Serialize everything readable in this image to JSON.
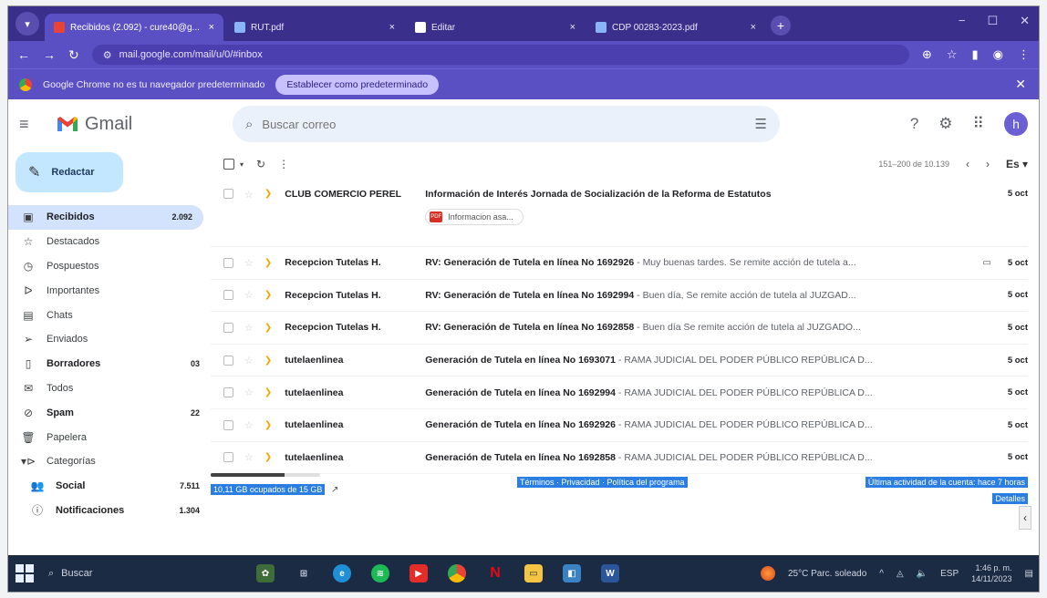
{
  "browser": {
    "tabs": [
      {
        "title": "Recibidos (2.092) - cure40@g...",
        "favicon_color": "#ea4335",
        "active": true
      },
      {
        "title": "RUT.pdf",
        "favicon_color": "#8ab4f8",
        "active": false
      },
      {
        "title": "Editar",
        "favicon_color": "#ffffff",
        "active": false
      },
      {
        "title": "CDP 00283-2023.pdf",
        "favicon_color": "#8ab4f8",
        "active": false
      }
    ],
    "close_tab_glyph": "×",
    "new_tab_glyph": "+",
    "url": "mail.google.com/mail/u/0/#inbox",
    "infobar_text": "Google Chrome no es tu navegador predeterminado",
    "infobar_button": "Establecer como predeterminado"
  },
  "gmail": {
    "logo_text": "Gmail",
    "search_placeholder": "Buscar correo",
    "avatar_letter": "h",
    "compose_label": "Redactar",
    "nav": [
      {
        "label": "Recibidos",
        "count": "2.092",
        "icon": "inbox-icon",
        "glyph": "▣",
        "active": true,
        "bold": true,
        "sub": false
      },
      {
        "label": "Destacados",
        "count": "",
        "icon": "star-icon",
        "glyph": "☆",
        "active": false,
        "bold": false,
        "sub": false
      },
      {
        "label": "Pospuestos",
        "count": "",
        "icon": "clock-icon",
        "glyph": "◷",
        "active": false,
        "bold": false,
        "sub": false
      },
      {
        "label": "Importantes",
        "count": "",
        "icon": "label-important-icon",
        "glyph": "ᐅ",
        "active": false,
        "bold": false,
        "sub": false
      },
      {
        "label": "Chats",
        "count": "",
        "icon": "chat-icon",
        "glyph": "▤",
        "active": false,
        "bold": false,
        "sub": false
      },
      {
        "label": "Enviados",
        "count": "",
        "icon": "send-icon",
        "glyph": "➢",
        "active": false,
        "bold": false,
        "sub": false
      },
      {
        "label": "Borradores",
        "count": "03",
        "icon": "draft-icon",
        "glyph": "▯",
        "active": false,
        "bold": true,
        "sub": false
      },
      {
        "label": "Todos",
        "count": "",
        "icon": "all-mail-icon",
        "glyph": "✉",
        "active": false,
        "bold": false,
        "sub": false
      },
      {
        "label": "Spam",
        "count": "22",
        "icon": "spam-icon",
        "glyph": "⊘",
        "active": false,
        "bold": true,
        "sub": false
      },
      {
        "label": "Papelera",
        "count": "",
        "icon": "trash-icon",
        "glyph": "🗑",
        "active": false,
        "bold": false,
        "sub": false
      },
      {
        "label": "Categorías",
        "count": "",
        "icon": "category-icon",
        "glyph": "▾⊳",
        "active": false,
        "bold": false,
        "sub": false
      },
      {
        "label": "Social",
        "count": "7.511",
        "icon": "social-icon",
        "glyph": "👥",
        "active": false,
        "bold": true,
        "sub": true
      },
      {
        "label": "Notificaciones",
        "count": "1.304",
        "icon": "info-icon",
        "glyph": "ⓘ",
        "active": false,
        "bold": true,
        "sub": true
      }
    ],
    "toolbar": {
      "pager_text": "151–200 de 10.139",
      "lang": "Es"
    },
    "emails": [
      {
        "sender": "CLUB COMERCIO PEREL",
        "subject": "Información de Interés Jornada de Socialización de la Reforma de Estatutos",
        "snippet": "",
        "date": "5 oct",
        "attachment": "Informacion asa...",
        "clip": false
      },
      {
        "sender": "Recepcion Tutelas H.",
        "subject": "RV: Generación de Tutela en línea No 1692926",
        "snippet": " - Muy buenas tardes. Se remite acción de tutela a...",
        "date": "5 oct",
        "attachment": "",
        "clip": true
      },
      {
        "sender": "Recepcion Tutelas H.",
        "subject": "RV: Generación de Tutela en línea No 1692994",
        "snippet": " - Buen día, Se remite acción de tutela al JUZGAD...",
        "date": "5 oct",
        "attachment": "",
        "clip": false
      },
      {
        "sender": "Recepcion Tutelas H.",
        "subject": "RV: Generación de Tutela en línea No 1692858",
        "snippet": " - Buen día Se remite acción de tutela al JUZGADO...",
        "date": "5 oct",
        "attachment": "",
        "clip": false
      },
      {
        "sender": "tutelaenlinea",
        "subject": "Generación de Tutela en línea No 1693071",
        "snippet": " - RAMA JUDICIAL DEL PODER PÚBLICO REPÚBLICA D...",
        "date": "5 oct",
        "attachment": "",
        "clip": false
      },
      {
        "sender": "tutelaenlinea",
        "subject": "Generación de Tutela en línea No 1692994",
        "snippet": " - RAMA JUDICIAL DEL PODER PÚBLICO REPÚBLICA D...",
        "date": "5 oct",
        "attachment": "",
        "clip": false
      },
      {
        "sender": "tutelaenlinea",
        "subject": "Generación de Tutela en línea No 1692926",
        "snippet": " - RAMA JUDICIAL DEL PODER PÚBLICO REPÚBLICA D...",
        "date": "5 oct",
        "attachment": "",
        "clip": false
      },
      {
        "sender": "tutelaenlinea",
        "subject": "Generación de Tutela en línea No 1692858",
        "snippet": " - RAMA JUDICIAL DEL PODER PÚBLICO REPÚBLICA D...",
        "date": "5 oct",
        "attachment": "",
        "clip": false
      }
    ],
    "footer": {
      "storage_text": "10,11 GB ocupados de 15 GB",
      "storage_fraction": 0.674,
      "links": "Términos · Privacidad · Política del programa",
      "last_activity": "Última actividad de la cuenta: hace 7 horas",
      "details": "Detalles"
    }
  },
  "taskbar": {
    "search_label": "Buscar",
    "weather": "25°C  Parc. soleado",
    "lang": "ESP",
    "time": "1:46 p. m.",
    "date": "14/11/2023"
  },
  "colors": {
    "chrome_frame": "#3a2f8a",
    "chrome_toolbar": "#5b4fc4",
    "compose_bg": "#c2e7ff",
    "nav_active": "#d3e3fd",
    "important_marker": "#f2a600",
    "taskbar": "#1c2b44"
  }
}
